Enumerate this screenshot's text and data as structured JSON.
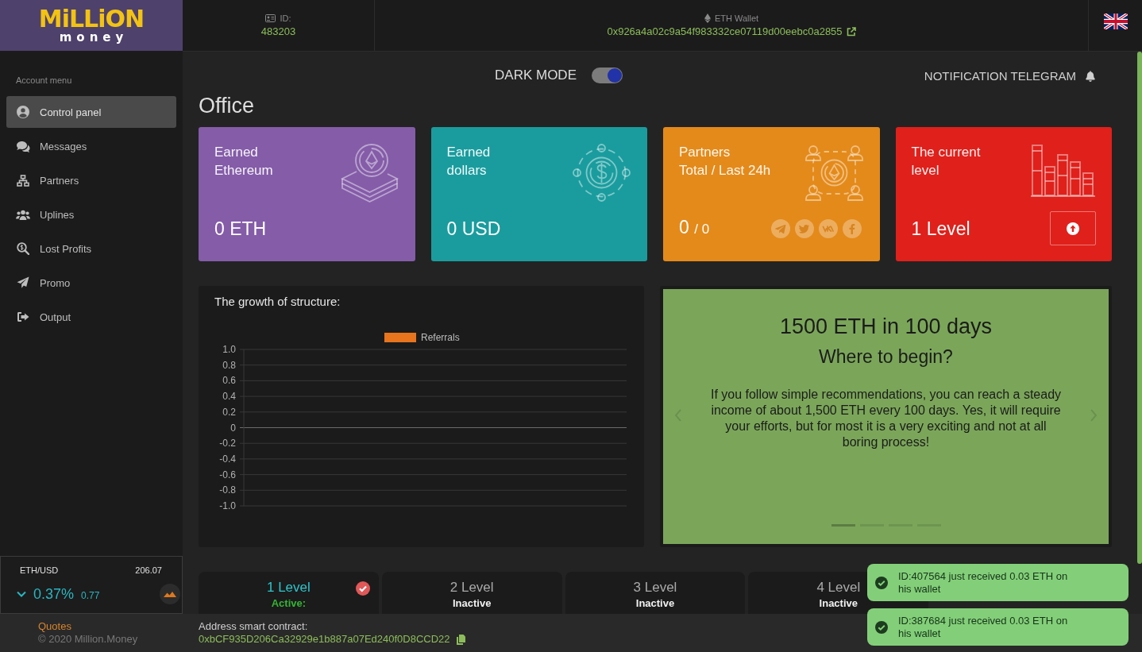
{
  "logo": {
    "wordmark": "MiLLiON",
    "tagline": "money"
  },
  "header": {
    "id_label": "ID:",
    "id_value": "483203",
    "wallet_label": "ETH Wallet",
    "wallet_address": "0x926a4a02c9a54f983332ce07119d00eebc0a2855"
  },
  "sidebar": {
    "heading": "Account menu",
    "items": [
      {
        "label": "Control panel",
        "selected": true
      },
      {
        "label": "Messages",
        "selected": false
      },
      {
        "label": "Partners",
        "selected": false
      },
      {
        "label": "Uplines",
        "selected": false
      },
      {
        "label": "Lost Profits",
        "selected": false
      },
      {
        "label": "Promo",
        "selected": false
      },
      {
        "label": "Output",
        "selected": false
      }
    ]
  },
  "quote_widget": {
    "pair": "ETH/USD",
    "price": "206.07",
    "change_percent": "0.37%",
    "change_value": "0.77",
    "rising": false
  },
  "sidebar_footer": {
    "link": "Quotes",
    "copyright": "© 2020 Million.Money"
  },
  "toolbar": {
    "dark_mode": {
      "label": "DARK MODE",
      "on": true
    },
    "notification": {
      "label": "NOTIFICATION TELEGRAM"
    }
  },
  "page_title": "Office",
  "stat_cards": [
    {
      "kind": "ethereum",
      "title": [
        "Earned",
        "Ethereum"
      ],
      "value": "0 ETH",
      "color": "#845ca8"
    },
    {
      "kind": "dollar",
      "title": [
        "Earned",
        "dollars"
      ],
      "value": "0 USD",
      "color": "#1a9c9e"
    },
    {
      "kind": "partners",
      "title": [
        "Partners",
        "Total / Last 24h"
      ],
      "value": "0",
      "value_secondary": "/ 0",
      "color": "#e48a1a"
    },
    {
      "kind": "level",
      "title": [
        "The current",
        "level"
      ],
      "value": "1 Level",
      "color": "#e0201b"
    }
  ],
  "chart": {
    "title": "The growth of structure:",
    "chart_data": {
      "type": "bar",
      "series": [
        {
          "name": "Referrals",
          "color": "#e8741e"
        }
      ],
      "ylim": [
        -1,
        1
      ],
      "yticks": [
        {
          "value": 1,
          "label": "1.0"
        },
        0.8,
        0.6,
        0.4,
        0.2,
        0,
        -0.2,
        -0.4,
        -0.6,
        -0.8,
        {
          "value": -1,
          "label": "-1.0"
        }
      ],
      "grid": true
    }
  },
  "promo": {
    "title": "1500 ETH in 100 days",
    "subtitle": "Where to begin?",
    "text": "If you follow simple recommendations, you can reach a steady income of about 1,500 ETH every 100 days. Yes, it will require your efforts, but for most it is a very exciting and not at all boring process!",
    "slides": [
      {
        "selected": true
      },
      {
        "selected": false
      },
      {
        "selected": false
      },
      {
        "selected": false
      }
    ]
  },
  "levels": [
    {
      "label": "1 Level",
      "status": "Active:",
      "active": true,
      "checked": true
    },
    {
      "label": "2 Level",
      "status": "Inactive",
      "active": false,
      "checked": false
    },
    {
      "label": "3 Level",
      "status": "Inactive",
      "active": false,
      "checked": false
    },
    {
      "label": "4 Level",
      "status": "Inactive",
      "active": false,
      "checked": false
    }
  ],
  "footer": {
    "contract_label": "Address smart contract:",
    "contract_address": "0xbCF935D206Ca32929e1b887a07Ed240f0D8CCD22"
  },
  "notifications": [
    {
      "text": "ID:407564 just received 0.03 ETH on his wallet"
    },
    {
      "text": "ID:387684 just received 0.03 ETH on his wallet"
    }
  ]
}
